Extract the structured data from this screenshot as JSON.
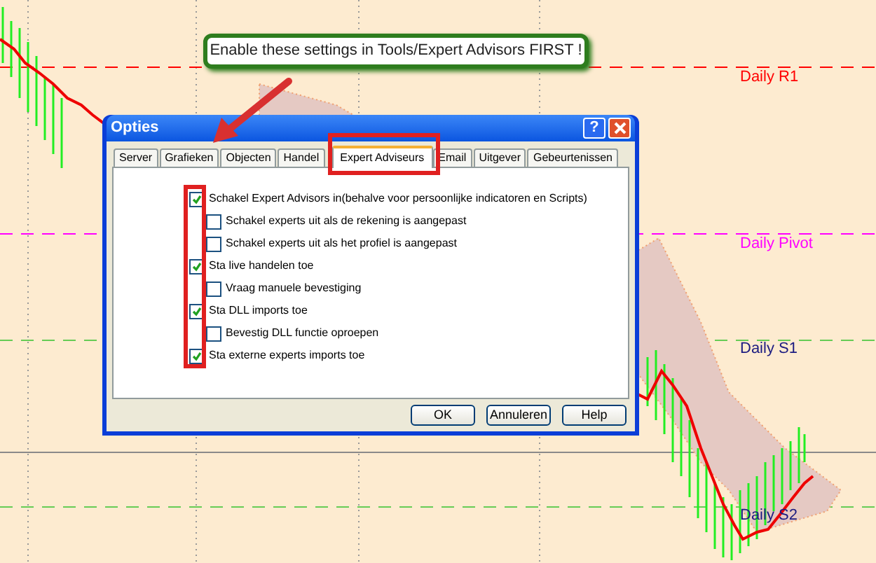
{
  "callout": {
    "text": "Enable these settings in Tools/Expert Advisors FIRST !"
  },
  "chart": {
    "levels": [
      {
        "label": "Daily R1",
        "color": "#ff0000"
      },
      {
        "label": "Daily Pivot",
        "color": "#ff00ff"
      },
      {
        "label": "Daily S1",
        "color": "#1a1a80"
      },
      {
        "label": "Daily S2",
        "color": "#1a1a80"
      }
    ]
  },
  "dialog": {
    "title": "Opties",
    "help_button": "?",
    "tabs": [
      {
        "label": "Server",
        "selected": false
      },
      {
        "label": "Grafieken",
        "selected": false
      },
      {
        "label": "Objecten",
        "selected": false
      },
      {
        "label": "Handel",
        "selected": false
      },
      {
        "label": "Expert Adviseurs",
        "selected": true
      },
      {
        "label": "Email",
        "selected": false
      },
      {
        "label": "Uitgever",
        "selected": false
      },
      {
        "label": "Gebeurtenissen",
        "selected": false
      }
    ],
    "options": [
      {
        "label": "Schakel Expert Advisors in(behalve voor persoonlijke indicatoren en Scripts)",
        "checked": true,
        "children": [
          {
            "label": "Schakel experts uit als de rekening is aangepast",
            "checked": false
          },
          {
            "label": "Schakel experts uit als het profiel is aangepast",
            "checked": false
          }
        ]
      },
      {
        "label": "Sta live handelen toe",
        "checked": true,
        "children": [
          {
            "label": "Vraag manuele bevestiging",
            "checked": false
          }
        ]
      },
      {
        "label": "Sta DLL imports toe",
        "checked": true,
        "children": [
          {
            "label": "Bevestig DLL functie oproepen",
            "checked": false
          }
        ]
      },
      {
        "label": "Sta externe experts imports toe",
        "checked": true
      }
    ],
    "buttons": [
      "OK",
      "Annuleren",
      "Help"
    ]
  }
}
